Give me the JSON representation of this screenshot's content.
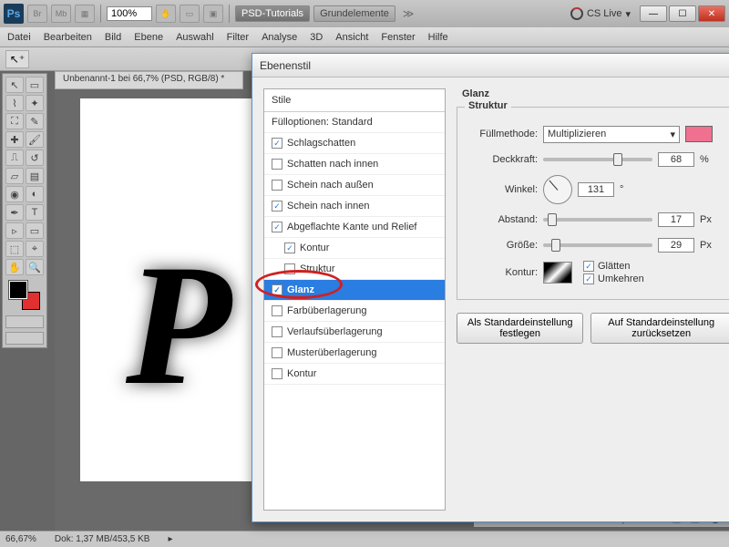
{
  "top": {
    "ps": "Ps",
    "br": "Br",
    "mb": "Mb",
    "zoom": "100%",
    "btn_active": "PSD-Tutorials",
    "btn_inactive": "Grundelemente",
    "cslive": "CS Live"
  },
  "menu": [
    "Datei",
    "Bearbeiten",
    "Bild",
    "Ebene",
    "Auswahl",
    "Filter",
    "Analyse",
    "3D",
    "Ansicht",
    "Fenster",
    "Hilfe"
  ],
  "doc_tab": "Unbenannt-1 bei 66,7% (PSD, RGB/8) *",
  "status": {
    "zoom": "66,67%",
    "doc": "Dok: 1,37 MB/453,5 KB"
  },
  "dialog": {
    "title": "Ebenenstil",
    "styles_header": "Stile",
    "fill_opt": "Fülloptionen: Standard",
    "rows": [
      {
        "label": "Schlagschatten",
        "checked": true
      },
      {
        "label": "Schatten nach innen",
        "checked": false
      },
      {
        "label": "Schein nach außen",
        "checked": false
      },
      {
        "label": "Schein nach innen",
        "checked": true
      },
      {
        "label": "Abgeflachte Kante und Relief",
        "checked": true
      },
      {
        "label": "Kontur",
        "checked": true,
        "sub": true
      },
      {
        "label": "Struktur",
        "checked": false,
        "sub": true
      },
      {
        "label": "Glanz",
        "checked": true,
        "selected": true
      },
      {
        "label": "Farbüberlagerung",
        "checked": false
      },
      {
        "label": "Verlaufsüberlagerung",
        "checked": false
      },
      {
        "label": "Musterüberlagerung",
        "checked": false
      },
      {
        "label": "Kontur",
        "checked": false
      }
    ],
    "section_title": "Glanz",
    "struktur": "Struktur",
    "blend_label": "Füllmethode:",
    "blend_value": "Multiplizieren",
    "opacity_label": "Deckkraft:",
    "opacity_val": "68",
    "opacity_unit": "%",
    "angle_label": "Winkel:",
    "angle_val": "131",
    "angle_unit": "°",
    "dist_label": "Abstand:",
    "dist_val": "17",
    "dist_unit": "Px",
    "size_label": "Größe:",
    "size_val": "29",
    "size_unit": "Px",
    "contour_label": "Kontur:",
    "anti_alias": "Glätten",
    "invert": "Umkehren",
    "btn_default": "Als Standardeinstellung festlegen",
    "btn_reset": "Auf Standardeinstellung zurücksetzen"
  },
  "canvas_letter": "P"
}
